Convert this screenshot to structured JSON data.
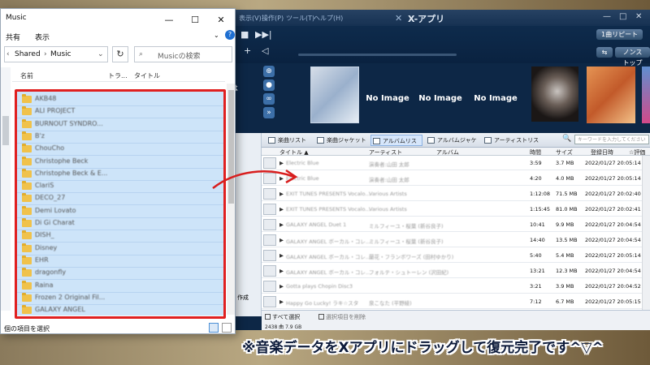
{
  "xapp": {
    "title": "X-アプリ",
    "menus": [
      "表示(V)",
      "操作(P)",
      "ツール(T)",
      "ヘルプ(H)"
    ],
    "repeat_label": "1曲リピート",
    "nonstop_label": "ノンストップ",
    "cover_labels": [
      "No Image",
      "No Image",
      "No Image"
    ],
    "tabs": [
      "楽曲リスト",
      "楽曲ジャケット",
      "アルバムリスト",
      "アルバムジャケット",
      "アーティストリスト"
    ],
    "search_placeholder": "キーワードを入力してください",
    "columns": {
      "title": "タイトル ▲",
      "artist": "アーティスト",
      "album": "アルバム",
      "time": "時間",
      "size": "サイズ",
      "date": "登録日時",
      "rating": "☆評価"
    },
    "rows": [
      {
        "title": "Electric Blue",
        "artist": "演奏者:山田 太郎",
        "time": "3:59",
        "size": "3.7 MB",
        "date": "2022/01/27 20:05:14"
      },
      {
        "title": "Electric Blue",
        "artist": "演奏者:山田 太郎",
        "time": "4:20",
        "size": "4.0 MB",
        "date": "2022/01/27 20:05:14"
      },
      {
        "title": "EXIT TUNES PRESENTS Vocalo...",
        "artist": "Various Artists",
        "time": "1:12:08",
        "size": "71.5 MB",
        "date": "2022/01/27 20:02:40"
      },
      {
        "title": "EXIT TUNES PRESENTS Vocalo...",
        "artist": "Various Artists",
        "time": "1:15:45",
        "size": "81.0 MB",
        "date": "2022/01/27 20:02:41"
      },
      {
        "title": "GALAXY ANGEL Duet 1",
        "artist": "ミルフィーユ・桜葉 (新谷良子)",
        "time": "10:41",
        "size": "9.9 MB",
        "date": "2022/01/27 20:04:54"
      },
      {
        "title": "GALAXY ANGEL ボーカル・コレ...",
        "artist": "ミルフィーユ・桜葉 (新谷良子)",
        "time": "14:40",
        "size": "13.5 MB",
        "date": "2022/01/27 20:04:54"
      },
      {
        "title": "GALAXY ANGEL ボーカル・コレ...",
        "artist": "蘭花・フランボワーズ (田村ゆかり)",
        "time": "5:40",
        "size": "5.4 MB",
        "date": "2022/01/27 20:05:14"
      },
      {
        "title": "GALAXY ANGEL ボーカル・コレ...",
        "artist": "フォルテ・シュトーレン (沢田紀)",
        "time": "13:21",
        "size": "12.3 MB",
        "date": "2022/01/27 20:04:54"
      },
      {
        "title": "Gotta plays Chopin Disc3",
        "artist": "",
        "time": "3:21",
        "size": "3.9 MB",
        "date": "2022/01/27 20:04:52"
      },
      {
        "title": "Happy Go Lucky! ラキ☆スタ",
        "artist": "泉こなた (平野綾)",
        "time": "7:12",
        "size": "6.7 MB",
        "date": "2022/01/27 20:05:15"
      }
    ],
    "select_all": "すべて選択",
    "delete_selected": "選択項目を削除",
    "status_line": "2438 曲 7.9 GB",
    "left_panel_labels": [
      "は",
      "作成"
    ]
  },
  "explorer": {
    "title": "Music",
    "ribbon": [
      "共有",
      "表示"
    ],
    "address": [
      "Shared",
      "Music"
    ],
    "search_placeholder": "Musicの検索",
    "columns": {
      "name": "名前",
      "track": "トラ...",
      "title": "タイトル"
    },
    "folders": [
      "AKB48",
      "ALI PROJECT",
      "BURNOUT SYNDRO...",
      "B'z",
      "ChouCho",
      "Christophe Beck",
      "Christophe Beck & E...",
      "ClariS",
      "DECO_27",
      "Demi Lovato",
      "Di Gi Charat",
      "DISH_",
      "Disney",
      "EHR",
      "dragonfly",
      "Raina",
      "Frozen 2 Original Fil...",
      "GALAXY ANGEL"
    ],
    "status": "個の項目を選択"
  },
  "caption": "※音楽データをXアプリにドラッグして復元完了です^▽^",
  "colors": {
    "highlight_box": "#e02020",
    "arrow": "#d81e1e",
    "xapp_bg": "#0d2746",
    "selection": "#cde4f9"
  }
}
